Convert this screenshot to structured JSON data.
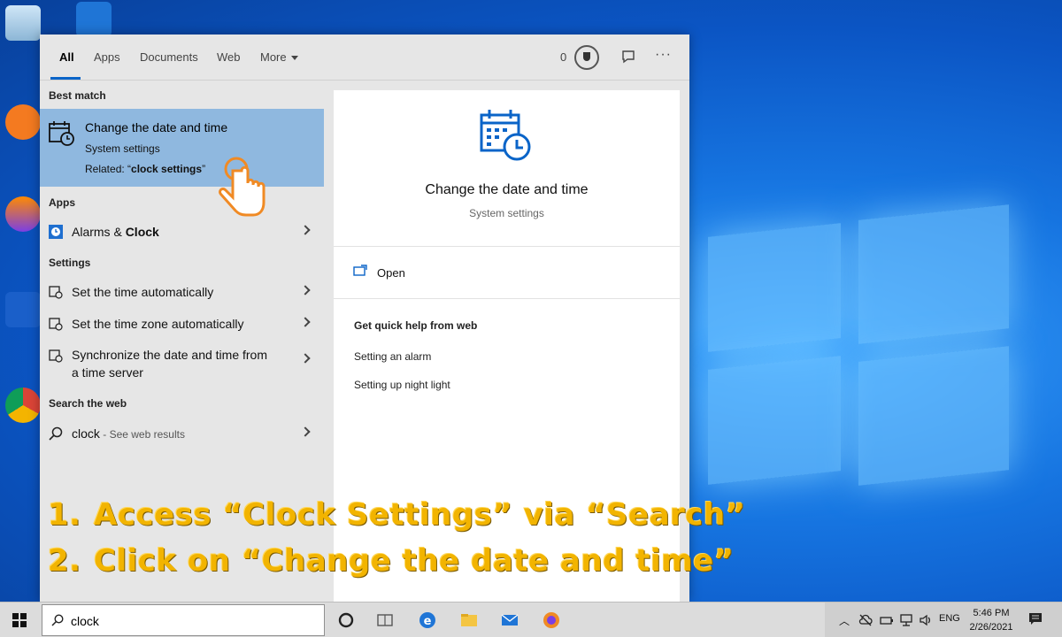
{
  "tabs": {
    "all": "All",
    "apps": "Apps",
    "documents": "Documents",
    "web": "Web",
    "more": "More"
  },
  "header": {
    "points": "0"
  },
  "sections": {
    "best_match": "Best match",
    "apps": "Apps",
    "settings": "Settings",
    "search_web": "Search the web"
  },
  "best_match": {
    "title": "Change the date and time",
    "subtitle": "System settings",
    "related_prefix": "Related: “",
    "related_bold": "clock settings",
    "related_suffix": "”"
  },
  "apps": [
    {
      "prefix": "Alarms & ",
      "bold": "Clock"
    }
  ],
  "settings": [
    {
      "label": "Set the time automatically"
    },
    {
      "label": "Set the time zone automatically"
    },
    {
      "label_line1": "Synchronize the date and time from",
      "label_line2": "a time server"
    }
  ],
  "web_result": {
    "query": "clock",
    "hint": " - See web results"
  },
  "detail": {
    "title": "Change the date and time",
    "subtitle": "System settings",
    "open_label": "Open",
    "help_heading": "Get quick help from web",
    "help_links": [
      "Setting an alarm",
      "Setting up night light"
    ]
  },
  "instructions": [
    {
      "num": "1.",
      "text": "Access “Clock Settings” via “Search”"
    },
    {
      "num": "2.",
      "text": "Click on “Change the date and time”"
    }
  ],
  "taskbar": {
    "search_value": "clock",
    "language": "ENG",
    "time": "5:46 PM",
    "date": "2/26/2021"
  },
  "colors": {
    "accent": "#0a64c8",
    "highlight": "#8fb8df",
    "instruction": "#f2b400"
  }
}
